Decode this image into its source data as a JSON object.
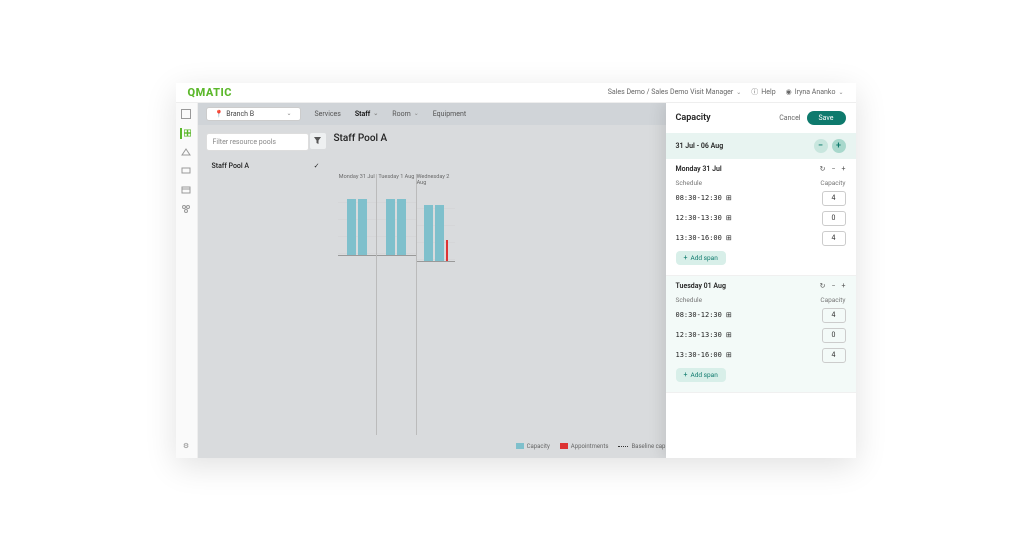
{
  "logo": "QMATIC",
  "topbar": {
    "breadcrumb": "Sales Demo / Sales Demo Visit Manager",
    "help": "Help",
    "user": "Iryna Ananko"
  },
  "branch": "Branch B",
  "tabs": [
    "Services",
    "Staff",
    "Room",
    "Equipment"
  ],
  "activeTab": 1,
  "filter": {
    "placeholder": "Filter resource pools"
  },
  "pools": [
    {
      "name": "Staff Pool A",
      "selected": true
    }
  ],
  "title": "Staff Pool A",
  "legend": {
    "cap": "Capacity",
    "app": "Appointments",
    "base": "Baseline cap"
  },
  "chart_data": {
    "type": "bar",
    "ylabel": "",
    "xlabel": "",
    "ylim": [
      0,
      5
    ],
    "yticks": [
      0,
      1,
      2,
      3,
      4,
      5
    ],
    "days": [
      {
        "label": "Monday 31 Jul",
        "bars": [
          4,
          4
        ],
        "appt": 0
      },
      {
        "label": "Tuesday 1 Aug",
        "bars": [
          4,
          4
        ],
        "appt": 0
      },
      {
        "label": "Wednesday 2 Aug",
        "bars": [
          4,
          4
        ],
        "appt": 1.5
      }
    ]
  },
  "panel": {
    "title": "Capacity",
    "cancel": "Cancel",
    "save": "Save",
    "range": "31 Jul - 06 Aug",
    "sched": "Schedule",
    "capLabel": "Capacity",
    "addSpan": "Add span",
    "days": [
      {
        "label": "Monday 31 Jul",
        "spans": [
          {
            "time": "08:30-12:30",
            "cap": "4"
          },
          {
            "time": "12:30-13:30",
            "cap": "0"
          },
          {
            "time": "13:30-16:00",
            "cap": "4"
          }
        ]
      },
      {
        "label": "Tuesday 01 Aug",
        "spans": [
          {
            "time": "08:30-12:30",
            "cap": "4"
          },
          {
            "time": "12:30-13:30",
            "cap": "0"
          },
          {
            "time": "13:30-16:00",
            "cap": "4"
          }
        ]
      }
    ]
  }
}
